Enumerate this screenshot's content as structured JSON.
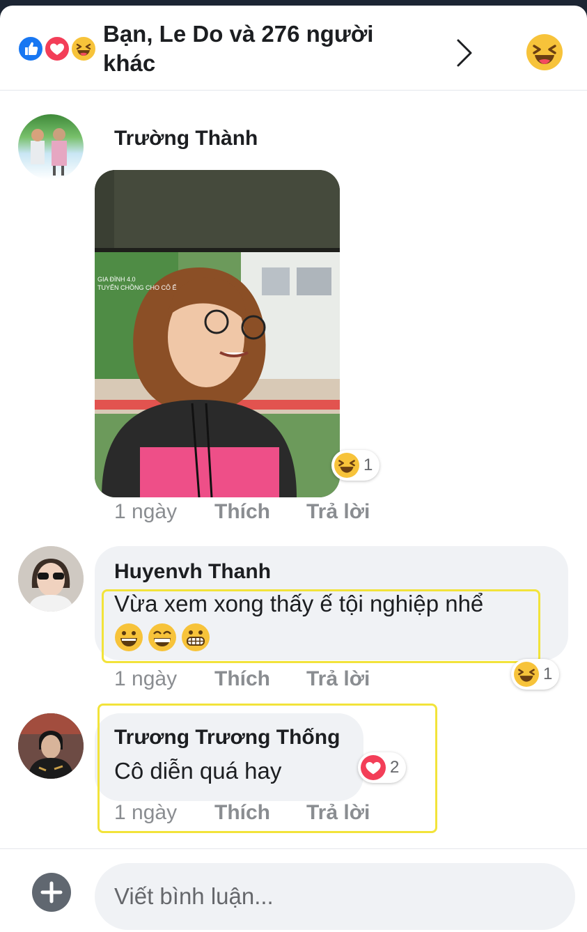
{
  "header": {
    "title": "Bạn, Le Do và 276 người khác",
    "reaction_icons": [
      "like-icon",
      "love-icon",
      "haha-icon"
    ],
    "right_icon": "haha-icon"
  },
  "comments": [
    {
      "author": "Trường Thành",
      "has_photo": true,
      "photo_caption_lines": [
        "GIA ĐÌNH 4.0",
        "TUYỂN CHỒNG CHO CÔ Ế"
      ],
      "reaction": {
        "icon": "haha-icon",
        "count": "1"
      },
      "time": "1 ngày",
      "like_label": "Thích",
      "reply_label": "Trả lời"
    },
    {
      "author": "Huyenvh Thanh",
      "text": "Vừa xem xong thấy ế tội nghiệp nhể",
      "emojis": "😀😁😬",
      "reaction": {
        "icon": "haha-icon",
        "count": "1"
      },
      "time": "1 ngày",
      "like_label": "Thích",
      "reply_label": "Trả lời"
    },
    {
      "author": "Trương Trương Thống",
      "text": "Cô diễn quá hay",
      "reaction": {
        "icon": "love-icon",
        "count": "2"
      },
      "time": "1 ngày",
      "like_label": "Thích",
      "reply_label": "Trả lời"
    }
  ],
  "composer": {
    "placeholder": "Viết bình luận...",
    "add_icon": "plus-icon"
  },
  "colors": {
    "like_blue": "#1877f2",
    "love_red": "#f33e58",
    "haha_yellow": "#f7c33a",
    "highlight": "#f2e33a",
    "bubble_gray": "#f0f2f5",
    "meta_gray": "#8a8d91"
  }
}
